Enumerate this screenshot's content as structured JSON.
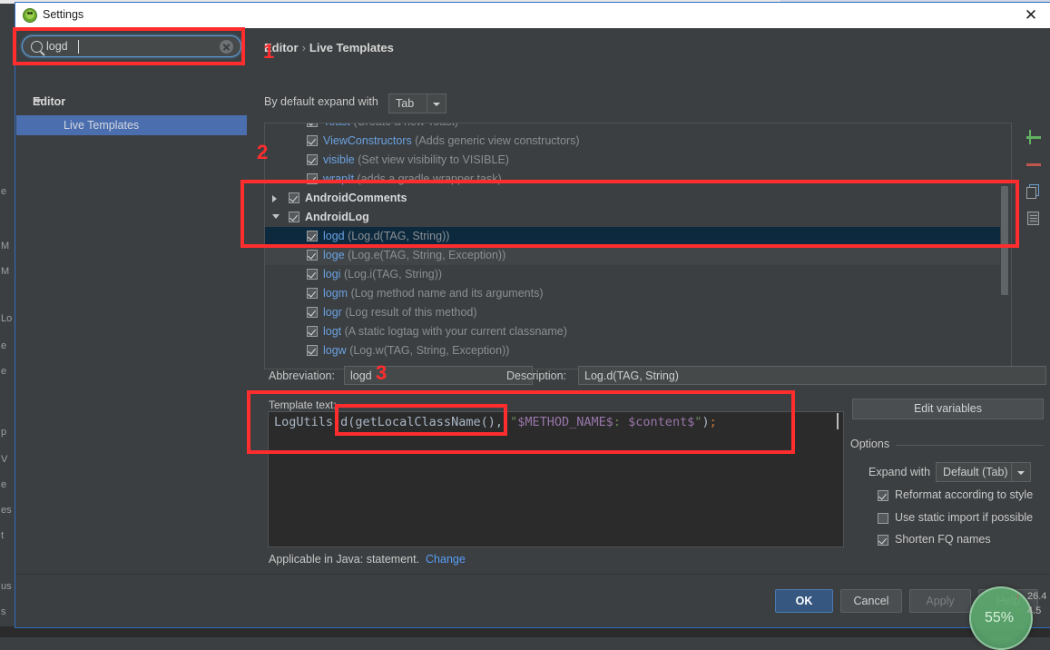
{
  "window": {
    "title": "Settings",
    "close_label": "✕",
    "app_icon": "android-robot-icon"
  },
  "search": {
    "value": "logd",
    "icon": "search-icon",
    "clear_icon": "clear-icon"
  },
  "sidebar": {
    "items": [
      {
        "label": "Editor",
        "expanded": true
      },
      {
        "label": "Live Templates",
        "selected": true
      }
    ]
  },
  "breadcrumb": {
    "root": "Editor",
    "sep": "›",
    "leaf": "Live Templates"
  },
  "expand_row": {
    "label": "By default expand with",
    "value": "Tab"
  },
  "template_list": [
    {
      "name": "Toast",
      "desc": "(Create a new Toast)",
      "type": "template",
      "checked": true,
      "selected": false
    },
    {
      "name": "ViewConstructors",
      "desc": "(Adds generic view constructors)",
      "type": "template",
      "checked": true,
      "selected": false
    },
    {
      "name": "visible",
      "desc": "(Set view visibility to VISIBLE)",
      "type": "template",
      "checked": true,
      "selected": false
    },
    {
      "name": "wrapIt",
      "desc": "(adds a gradle wrapper task)",
      "type": "template",
      "checked": true,
      "selected": false
    },
    {
      "name": "AndroidComments",
      "desc": "",
      "type": "group",
      "checked": true,
      "expanded": false
    },
    {
      "name": "AndroidLog",
      "desc": "",
      "type": "group",
      "checked": true,
      "expanded": true
    },
    {
      "name": "logd",
      "desc": "(Log.d(TAG, String))",
      "type": "template",
      "checked": true,
      "selected": true
    },
    {
      "name": "loge",
      "desc": "(Log.e(TAG, String, Exception))",
      "type": "template",
      "checked": true,
      "selected": false
    },
    {
      "name": "logi",
      "desc": "(Log.i(TAG, String))",
      "type": "template",
      "checked": true,
      "selected": false
    },
    {
      "name": "logm",
      "desc": "(Log method name and its arguments)",
      "type": "template",
      "checked": true,
      "selected": false
    },
    {
      "name": "logr",
      "desc": "(Log result of this method)",
      "type": "template",
      "checked": true,
      "selected": false
    },
    {
      "name": "logt",
      "desc": "(A static logtag with your current classname)",
      "type": "template",
      "checked": true,
      "selected": false
    },
    {
      "name": "logw",
      "desc": "(Log.w(TAG, String, Exception))",
      "type": "template",
      "checked": true,
      "selected": false
    }
  ],
  "list_toolbar": [
    {
      "icon": "add-icon",
      "color": "#62b062"
    },
    {
      "icon": "remove-icon",
      "color": "#c0574e"
    },
    {
      "icon": "duplicate-icon",
      "color": "#6a9fd0"
    },
    {
      "icon": "copy-to-icon",
      "color": "#9aa0a4"
    }
  ],
  "fields": {
    "abbreviation_label": "Abbreviation:",
    "abbreviation_value": "logd",
    "description_label": "Description:",
    "description_value": "Log.d(TAG, String)"
  },
  "template_text": {
    "label": "Template text:",
    "segments": [
      {
        "text": "LogUtils.d(getLocalClassName(), ",
        "style": "plain"
      },
      {
        "text": "\"",
        "style": "string"
      },
      {
        "text": "$METHOD_NAME$",
        "style": "variable"
      },
      {
        "text": ": ",
        "style": "string"
      },
      {
        "text": "$content$",
        "style": "variable"
      },
      {
        "text": "\"",
        "style": "string"
      },
      {
        "text": ")",
        "style": "plain"
      },
      {
        "text": ";",
        "style": "semicolon"
      }
    ],
    "full": "LogUtils.d(getLocalClassName(), \"$METHOD_NAME$: $content$\");"
  },
  "applicable": {
    "text": "Applicable in Java: statement.",
    "link": "Change"
  },
  "options": {
    "edit_variables": "Edit variables",
    "title": "Options",
    "expand_with_label": "Expand with",
    "expand_with_value": "Default (Tab)",
    "checkboxes": [
      {
        "label": "Reformat according to style",
        "checked": true
      },
      {
        "label": "Use static import if possible",
        "checked": false
      },
      {
        "label": "Shorten FQ names",
        "checked": true
      }
    ]
  },
  "footer": {
    "ok": "OK",
    "cancel": "Cancel",
    "apply": "Apply",
    "help": "Help"
  },
  "overlay": {
    "percent": "55%",
    "up_arrow": "↑",
    "down_arrow": "↓",
    "up_value": "26.4",
    "down_value": "4.5"
  },
  "annotations": [
    {
      "number": "1"
    },
    {
      "number": "2"
    },
    {
      "number": "3"
    }
  ],
  "bg_fragments": [
    "e",
    "M",
    "M",
    "Lo",
    "e",
    "e",
    "p",
    "V",
    "e",
    "es",
    "t",
    "us",
    "s"
  ],
  "colors": {
    "accent_blue": "#4b6eaf",
    "selection": "#0d293e",
    "annotation_red": "#ff2d2d",
    "link": "#589df6",
    "template_name": "#6aa1e0"
  }
}
